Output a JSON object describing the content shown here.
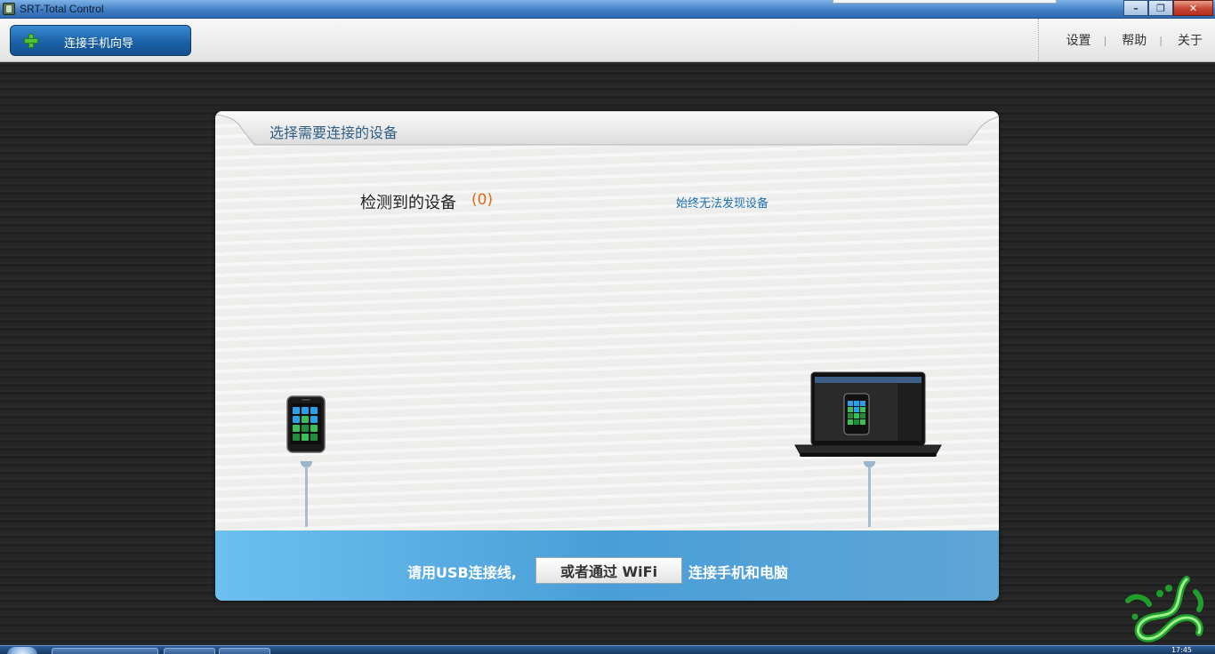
{
  "window": {
    "title": "SRT-Total Control",
    "minimize_glyph": "–",
    "maximize_glyph": "❐",
    "close_glyph": "✕"
  },
  "toolbar": {
    "wizard_label": "连接手机向导",
    "nav": {
      "settings": "设置",
      "help": "帮助",
      "about": "关于",
      "separator": "|"
    }
  },
  "panel": {
    "title": "选择需要连接的设备",
    "detected_label": "检测到的设备",
    "detected_count": "(0)",
    "not_found_link": "始终无法发现设备"
  },
  "bottom_bar": {
    "text_before": "请用USB连接线,",
    "wifi_button": "或者通过 WiFi",
    "text_after": "连接手机和电脑"
  },
  "taskbar": {
    "clock": "17:45"
  },
  "colors": {
    "accent_blue": "#1b62a8",
    "title_blue": "#2f5f86",
    "count_orange": "#e06a16",
    "link_blue": "#1d6fb0",
    "bar_blue": "#4a9ed8"
  },
  "icons": [
    "app-icon",
    "plus-icon",
    "phone-icon",
    "laptop-icon",
    "watermark-logo"
  ]
}
